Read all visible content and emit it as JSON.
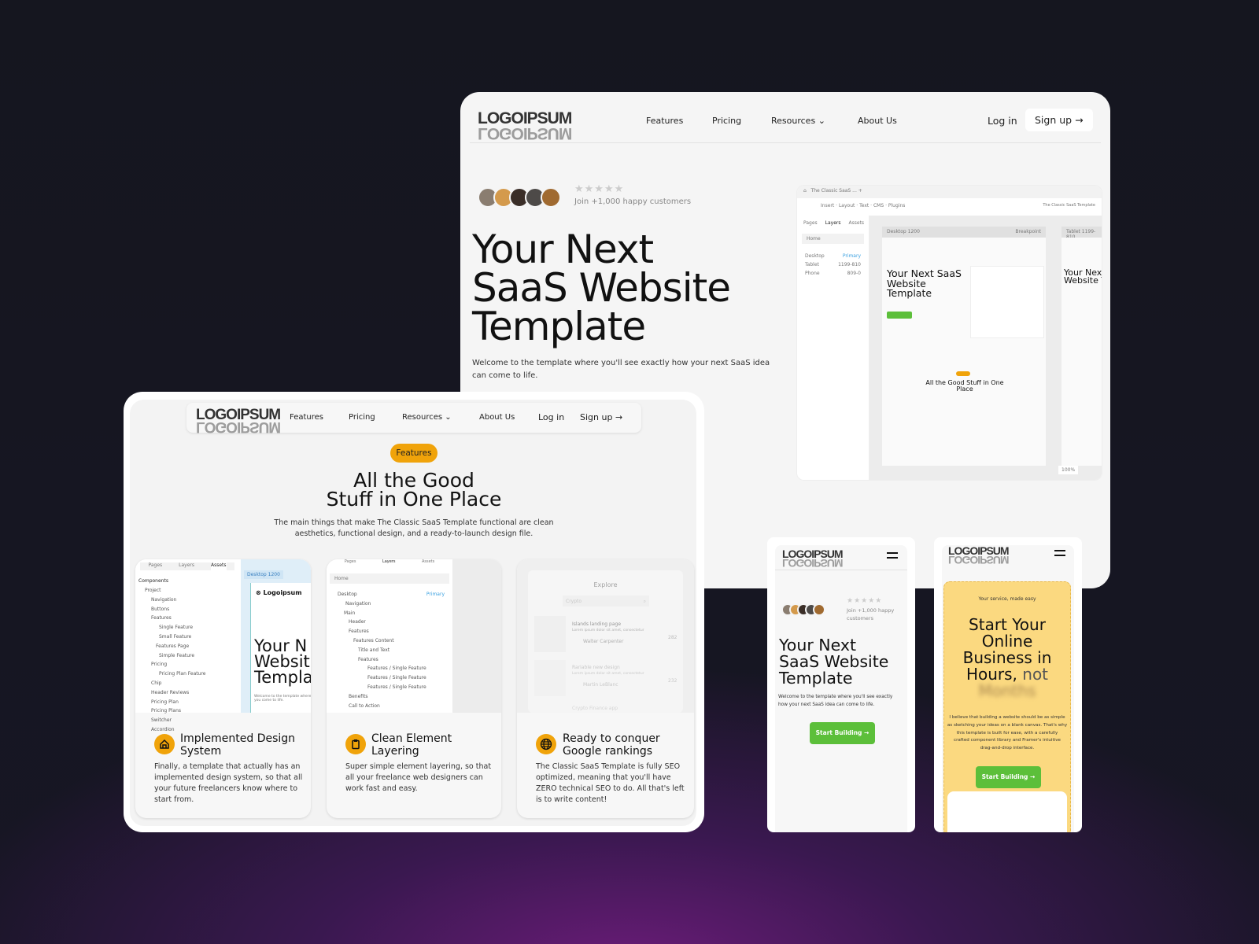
{
  "brand": {
    "logo": "LOGOIPSUM"
  },
  "colors": {
    "accent": "#f0a30a",
    "green": "#5cbf3a",
    "yellow_panel": "#fbd980",
    "background": "#15161f",
    "purple_glow": "#6a1c78"
  },
  "nav": {
    "items": [
      "Features",
      "Pricing",
      "Resources",
      "About Us"
    ],
    "login": "Log in",
    "signup": "Sign up"
  },
  "hero": {
    "customers": "Join +1,000 happy customers",
    "stars": 5,
    "title": [
      "Your Next",
      "SaaS Website",
      "Template"
    ],
    "subtitle": "Welcome to the template where you'll see exactly how your next SaaS idea can come to life.",
    "cta": "Start Building"
  },
  "editor": {
    "tab": "The Classic SaaS ...",
    "toolbar": [
      "Insert",
      "Layout",
      "Text",
      "CMS",
      "Plugins"
    ],
    "project": "The Classic SaaS Template",
    "panel_tabs": [
      "Pages",
      "Layers",
      "Assets"
    ],
    "page": "Home",
    "frames": [
      {
        "name": "Desktop",
        "note": "Primary"
      },
      {
        "name": "Tablet",
        "note": "1199-810"
      },
      {
        "name": "Phone",
        "note": "809-0"
      }
    ],
    "frame_label": "Desktop 1200",
    "breakpoint": "Breakpoint",
    "mini_title": "Your Next SaaS Website Template",
    "mini_feat": "All the Good Stuff in One Place",
    "tablet_label": "Tablet 1199-810",
    "zoom": "100%"
  },
  "features": {
    "badge": "Features",
    "title": [
      "All the Good",
      "Stuff in One Place"
    ],
    "desc": [
      "The main things that make The Classic SaaS Template functional are clean",
      "aesthetics, functional design, and a ready-to-launch design file."
    ],
    "cards": [
      {
        "icon": "house-icon",
        "title": [
          "Implemented Design",
          "System"
        ],
        "desc": [
          "Finally, a template that actually has an",
          "implemented design system, so that all",
          "your future freelancers know where to",
          "start from."
        ]
      },
      {
        "icon": "clipboard-icon",
        "title": [
          "Clean Element",
          "Layering"
        ],
        "desc": [
          "Super simple element layering, so that",
          "all your freelance web designers can",
          "work fast and easy."
        ]
      },
      {
        "icon": "globe-icon",
        "title": [
          "Ready to conquer",
          "Google rankings"
        ],
        "desc": [
          "The Classic SaaS Template is fully SEO",
          "optimized, meaning that you'll have",
          "ZERO technical SEO to do. All that's left",
          "is to write content!"
        ]
      }
    ]
  },
  "assets_panel": {
    "tabs": [
      "Pages",
      "Layers",
      "Assets"
    ],
    "header": "Components",
    "items": [
      "Project",
      "Navigation",
      "Buttons",
      "Features",
      "Single Feature",
      "Small Feature",
      "Features Page",
      "Simple Feature",
      "Pricing",
      "Pricing Plan Feature",
      "Chip",
      "Header Reviews",
      "Pricing Plan",
      "Pricing Plans",
      "Switcher",
      "Accordion"
    ],
    "frame": "Desktop 1200",
    "mini_logo": "Logoipsum",
    "mini_title": [
      "Your N",
      "Websit",
      "Templa"
    ],
    "mini_sub": "Welcome to the template where you come to life."
  },
  "layers_panel": {
    "tabs": [
      "Pages",
      "Layers",
      "Assets"
    ],
    "page": "Home",
    "items": [
      "Desktop",
      "Navigation",
      "Main",
      "Header",
      "Features",
      "Features Content",
      "Title and Text",
      "Features",
      "Features / Single Feature",
      "Features / Single Feature",
      "Features / Single Feature",
      "Benefits",
      "Call to Action"
    ],
    "primary": "Primary"
  },
  "explore_panel": {
    "title": "Explore",
    "search": "Crypto",
    "items": [
      {
        "title": "Islands landing page",
        "desc": "Lorem ipsum dolor sit amet, consectetur",
        "author": "Walter Carpenter",
        "votes": "282"
      },
      {
        "title": "Rariable new design",
        "desc": "Lorem ipsum dolor sit amet, consectetur",
        "author": "Martin LeBlanc",
        "votes": "232"
      },
      {
        "title": "Crypto Finance app"
      }
    ]
  },
  "mobile2": {
    "eyebrow": "Your service, made easy",
    "title": [
      "Start Your",
      "Online",
      "Business in",
      "Hours,"
    ],
    "title_accent": "not",
    "title_blur": "Months",
    "desc": [
      "I believe that building a website should be as simple",
      "as sketching your ideas on a blank canvas. That's why",
      "this template is built for ease, with a carefully",
      "crafted component library and Framer's intuitive",
      "drag-and-drop interface."
    ],
    "cta": "Start Building"
  },
  "mobile1": {
    "customers": [
      "Join +1,000 happy",
      "customers"
    ],
    "subtitle": [
      "Welcome to the template where you'll see exactly",
      "how your next SaaS idea can come to life."
    ]
  }
}
